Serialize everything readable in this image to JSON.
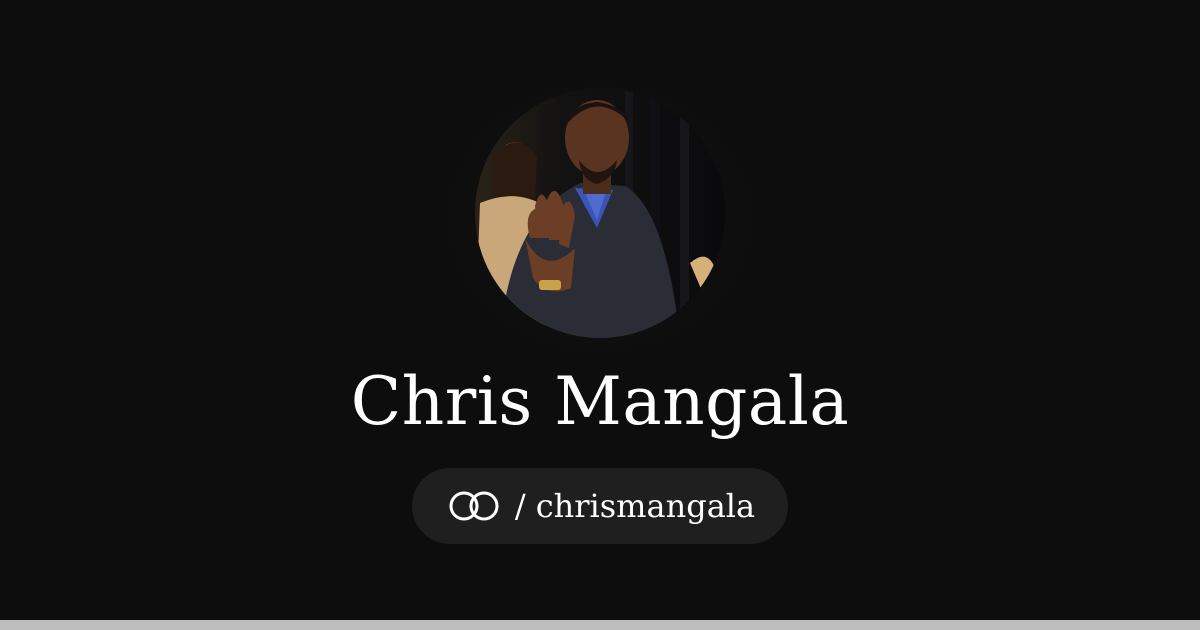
{
  "profile": {
    "name": "Chris Mangala",
    "separator": "/",
    "handle": "chrismangala",
    "avatar_icon": "profile-photo",
    "link_icon": "linked-rings-icon"
  },
  "colors": {
    "background": "#0d0d0d",
    "pill": "#1f1f1f",
    "text": "#ffffff",
    "bottom_bar": "#bdbdbd"
  }
}
